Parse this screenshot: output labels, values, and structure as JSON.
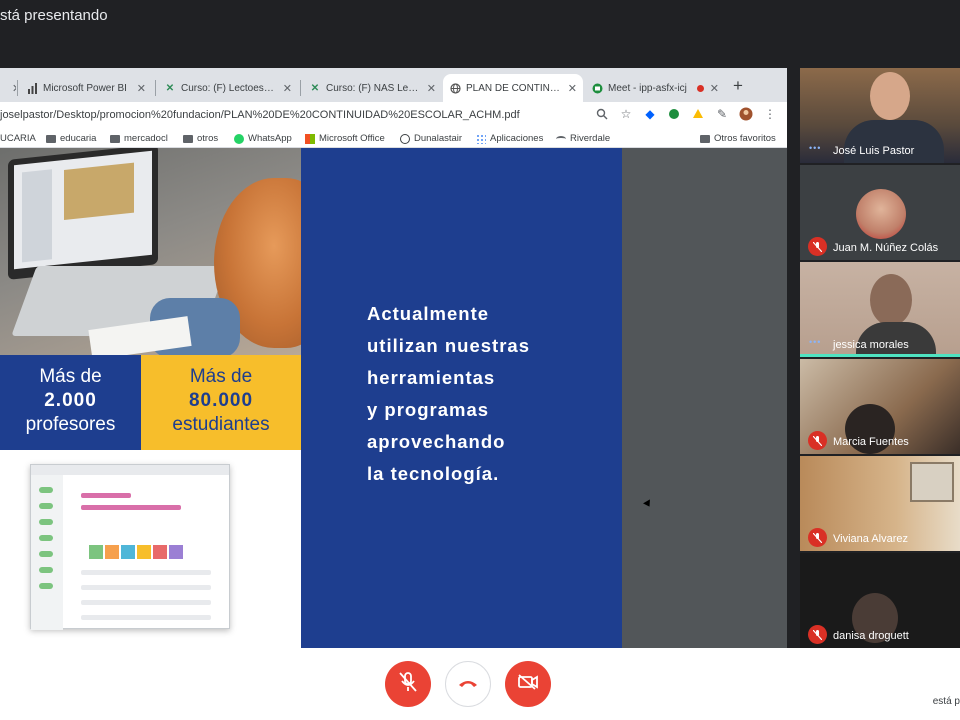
{
  "banner": {
    "text": "stá presentando"
  },
  "browser": {
    "tabs": [
      {
        "label": "",
        "icon": "close-icon"
      },
      {
        "label": "Microsoft Power BI",
        "icon": "powerbi-icon"
      },
      {
        "label": "Curso: (F) Lectoescritu",
        "icon": "moodle-icon"
      },
      {
        "label": "Curso: (F) NAS Lengua",
        "icon": "moodle-icon"
      },
      {
        "label": "PLAN DE CONTINUIDA",
        "icon": "globe-icon"
      },
      {
        "label": "Meet - ipp-asfx-icj",
        "icon": "meet-icon"
      }
    ],
    "address": "joselpastor/Desktop/promocion%20fundacion/PLAN%20DE%20CONTINUIDAD%20ESCOLAR_ACHM.pdf",
    "bookmarks": [
      {
        "label": "UCARIA",
        "icon": ""
      },
      {
        "label": "educaria",
        "icon": "folder-icon"
      },
      {
        "label": "mercadocl",
        "icon": "folder-icon"
      },
      {
        "label": "otros",
        "icon": "folder-icon"
      },
      {
        "label": "WhatsApp",
        "icon": "whatsapp-icon"
      },
      {
        "label": "Microsoft Office",
        "icon": "office-icon"
      },
      {
        "label": "Dunalastair",
        "icon": "globe-icon"
      },
      {
        "label": "Aplicaciones",
        "icon": "apps-icon"
      },
      {
        "label": "Riverdale",
        "icon": "wifi-icon"
      },
      {
        "label": "Otros favoritos",
        "icon": "folder-icon"
      }
    ]
  },
  "slide": {
    "stat_left": {
      "line1": "Más de",
      "number": "2.000",
      "line3": "profesores"
    },
    "stat_right": {
      "line1": "Más de",
      "number": "80.000",
      "line3": "estudiantes"
    },
    "panel_text": "Actualmente\nutilizan nuestras\nherramientas\ny programas\naprovechando\nla tecnología.",
    "colors": {
      "blue": "#1e3e8f",
      "yellow": "#f7be2b"
    }
  },
  "participants": [
    {
      "name": "José Luis Pastor",
      "status": "speaking"
    },
    {
      "name": "Juan M. Núñez Colás",
      "status": "muted"
    },
    {
      "name": "jessica morales",
      "status": "speaking"
    },
    {
      "name": "Marcia Fuentes",
      "status": "muted"
    },
    {
      "name": "Viviana Alvarez",
      "status": "muted"
    },
    {
      "name": "danisa droguett",
      "status": "muted"
    }
  ],
  "controls": {
    "mic": "mic-off-icon",
    "hangup": "hangup-icon",
    "camera": "camera-off-icon",
    "presenting_text": "está p"
  },
  "ui_colors": {
    "danger": "#ea4335",
    "active_speaker": "#4fe3c1"
  }
}
